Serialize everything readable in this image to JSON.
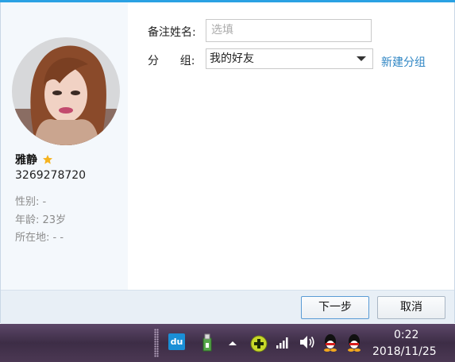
{
  "profile": {
    "name": "雅静",
    "qq_number": "3269278720",
    "gender": "性别:  -",
    "age": "年龄: 23岁",
    "location": "所在地:  -    -"
  },
  "form": {
    "remark_label": "备注姓名:",
    "remark_placeholder": "选填",
    "group_label": "分      组:",
    "group_value": "我的好友",
    "new_group_link": "新建分组"
  },
  "buttons": {
    "next": "下一步",
    "cancel": "取消"
  },
  "taskbar": {
    "time": "0:22",
    "date": "2018/11/25",
    "baidu_icon_text": "du"
  },
  "colors": {
    "accent": "#2aa1e3",
    "link": "#2f86c4",
    "star": "#f5b31f"
  },
  "icons": [
    "star-icon",
    "dropdown-arrow-icon",
    "baidu-icon",
    "usb-icon",
    "show-hidden-icon",
    "plus-icon",
    "signal-icon",
    "volume-icon",
    "qq-icon"
  ]
}
